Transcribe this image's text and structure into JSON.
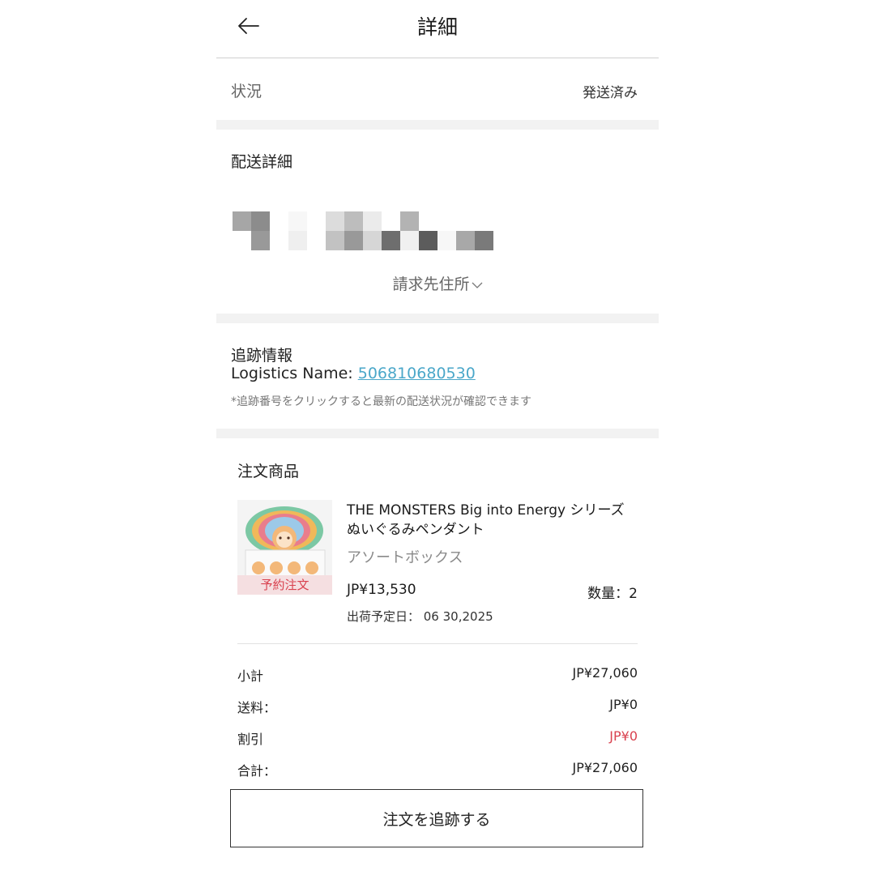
{
  "header": {
    "title": "詳細"
  },
  "status": {
    "label": "状況",
    "value": "発送済み"
  },
  "shipping": {
    "title": "配送詳細",
    "billing_toggle": "請求先住所"
  },
  "tracking": {
    "title": "追跡情報",
    "logistics_label": "Logistics Name: ",
    "tracking_number": "506810680530",
    "note": "*追跡番号をクリックすると最新の配送状況が確認できます"
  },
  "order": {
    "title": "注文商品",
    "item": {
      "badge": "予約注文",
      "name": "THE MONSTERS Big into Energy シリーズ ぬいぐるみペンダント",
      "variant": "アソートボックス",
      "price": "JP¥13,530",
      "quantity": "数量：2",
      "ship_date": "出荷予定日：  06 30,2025"
    }
  },
  "summary": {
    "subtotal_label": "小計",
    "subtotal_value": "JP¥27,060",
    "shipping_label": "送料：",
    "shipping_value": "JP¥0",
    "discount_label": "割引",
    "discount_value": "JP¥0",
    "total_label": "合計：",
    "total_value": "JP¥27,060"
  },
  "actions": {
    "track_order": "注文を追跡する"
  },
  "colors": {
    "link": "#4aa7c9",
    "discount": "#d9424f",
    "separator": "#f2f2f2"
  },
  "icons": {
    "back": "arrow-left-icon",
    "billing_toggle": "chevron-down-icon"
  }
}
